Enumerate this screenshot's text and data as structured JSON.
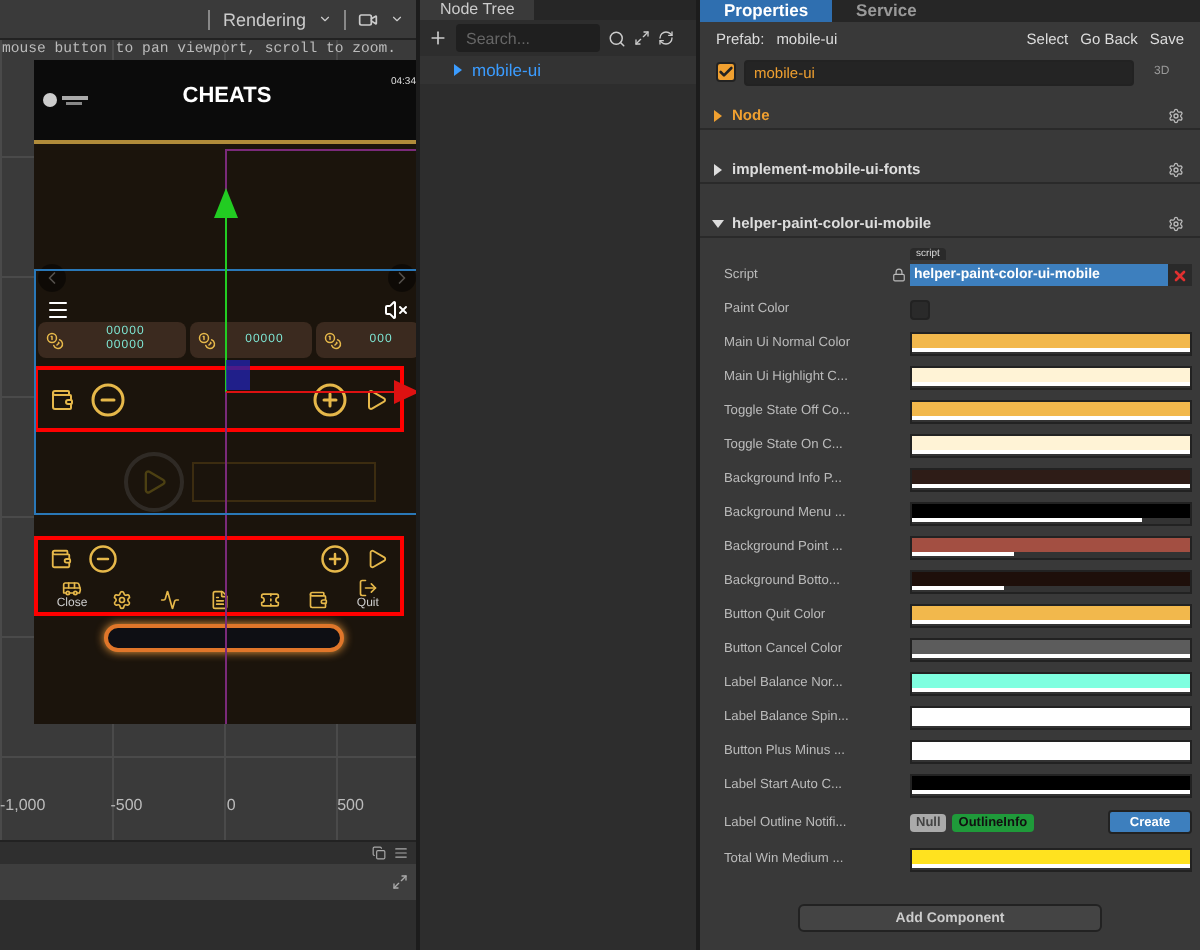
{
  "viewport": {
    "toolbar": {
      "mode": "Rendering"
    },
    "hint": "mouse button to pan viewport, scroll to zoom.",
    "preview": {
      "title": "CHEATS",
      "clock": "04:34",
      "balances": [
        {
          "values": [
            "00000",
            "00000"
          ]
        },
        {
          "values": [
            "00000"
          ]
        },
        {
          "values": [
            "000"
          ]
        }
      ],
      "menu_labels": [
        "Close",
        "Quit"
      ]
    },
    "ruler": [
      "-1,000",
      "-500",
      "0",
      "500"
    ]
  },
  "node_tree": {
    "title": "Node Tree",
    "search": {
      "placeholder": "Search..."
    },
    "items": [
      {
        "label": "mobile-ui",
        "expanded": false
      }
    ]
  },
  "properties": {
    "tabs": [
      {
        "label": "Properties",
        "selected": true
      },
      {
        "label": "Service",
        "selected": false
      }
    ],
    "prefab_label": "Prefab:",
    "prefab": "mobile-ui",
    "actions": [
      "Select",
      "Go Back",
      "Save"
    ],
    "node": {
      "active": true,
      "name": "mobile-ui",
      "mode": "3D"
    },
    "sections": [
      {
        "kind": "node",
        "title": "Node",
        "expanded": false
      },
      {
        "kind": "component",
        "title": "implement-mobile-ui-fonts",
        "expanded": false
      },
      {
        "kind": "component",
        "title": "helper-paint-color-ui-mobile",
        "expanded": true,
        "props": [
          {
            "kind": "script",
            "label": "Script",
            "tag": "script",
            "value": "helper-paint-color-ui-mobile"
          },
          {
            "kind": "checkbox",
            "label": "Paint Color",
            "checked": false
          },
          {
            "kind": "color",
            "label": "Main Ui Normal Color",
            "color": "#f2b84c",
            "level": 1
          },
          {
            "kind": "color",
            "label": "Main Ui Highlight C...",
            "color": "#fff3d6",
            "level": 1
          },
          {
            "kind": "color",
            "label": "Toggle State Off Co...",
            "color": "#f2b84c",
            "level": 1
          },
          {
            "kind": "color",
            "label": "Toggle State On C...",
            "color": "#fff3d6",
            "level": 1
          },
          {
            "kind": "color",
            "label": "Background Info P...",
            "color": "#2e1c17",
            "level": 1
          },
          {
            "kind": "color",
            "label": "Background Menu ...",
            "color": "#000000",
            "level": 0.83
          },
          {
            "kind": "color",
            "label": "Background Point ...",
            "color": "#a34f42",
            "level": 0.37
          },
          {
            "kind": "color",
            "label": "Background Botto...",
            "color": "#1e0f0a",
            "level": 0.33
          },
          {
            "kind": "color",
            "label": "Button Quit Color",
            "color": "#f2b84c",
            "level": 1
          },
          {
            "kind": "color",
            "label": "Button Cancel Color",
            "color": "#5c5c5c",
            "level": 1
          },
          {
            "kind": "color",
            "label": "Label Balance Nor...",
            "color": "#7fffe0",
            "level": 1
          },
          {
            "kind": "color",
            "label": "Label Balance Spin...",
            "color": "#ffffff",
            "level": 1
          },
          {
            "kind": "color",
            "label": "Button Plus Minus ...",
            "color": "#ffffff",
            "level": 1
          },
          {
            "kind": "color",
            "label": "Label Start Auto C...",
            "color": "#000000",
            "level": 1
          },
          {
            "kind": "object",
            "label": "Label Outline Notifi...",
            "value": "Null",
            "type": "OutlineInfo",
            "action": "Create"
          },
          {
            "kind": "color",
            "label": "Total Win Medium ...",
            "color": "#ffe21f",
            "level": 1
          }
        ]
      }
    ],
    "add_component": "Add Component"
  }
}
